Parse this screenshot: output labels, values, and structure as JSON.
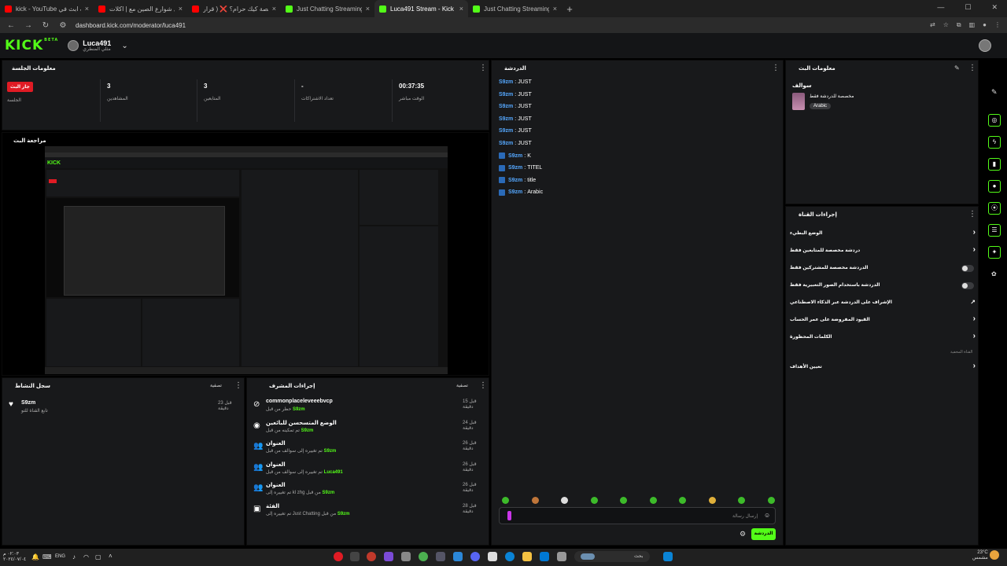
{
  "browser": {
    "tabs": [
      {
        "title": "kick - YouTube كيف ابث في",
        "color": "#ff0000",
        "active": false
      },
      {
        "title": "تجربة اكل شوارع الصين مع | اكلات",
        "color": "#ff0000",
        "active": false
      },
      {
        "title": "هل منصة كيك حرام؟ ❌ ( قرار",
        "color": "#ff0000",
        "active": false
      },
      {
        "title": "Just Chatting Streaming - Live",
        "color": "#53fc18",
        "active": false
      },
      {
        "title": "Luca491 Stream - Kick Dashbo",
        "color": "#53fc18",
        "active": true
      },
      {
        "title": "Just Chatting Streaming - Live",
        "color": "#53fc18",
        "active": false
      }
    ],
    "url": "dashboard.kick.com/moderator/luca491"
  },
  "header": {
    "logo": "KICK",
    "logo_badge": "BETA",
    "channel_name": "Luca491",
    "channel_sub": "مثلي المنطري"
  },
  "session": {
    "title": "معلومات الجلسة",
    "live_badge": "جار البث",
    "live_label": "الجلسة",
    "stats": [
      {
        "value": "3",
        "label": "المشاهدين"
      },
      {
        "value": "3",
        "label": "المتابعين"
      },
      {
        "value": "-",
        "label": "تعداد الاشتراكات"
      },
      {
        "value": "00:37:35",
        "label": "الوقت مباشر"
      }
    ]
  },
  "preview": {
    "title": "مراجعة البث"
  },
  "activity": {
    "title": "سجل النشاط",
    "filter": "تصفية",
    "items": [
      {
        "user": "S9zm",
        "text": "تابع القناة للتو",
        "time": "قبل 23 دقيقة"
      }
    ]
  },
  "mod_actions": {
    "title": "إجراءات المشرف",
    "filter": "تصفية",
    "items": [
      {
        "icon": "ban-icon",
        "title": "commonplaceleveeebvcp",
        "sub_pre": "حظر من قبل",
        "user": "S9zm",
        "time": "قبل 15 دقيقة"
      },
      {
        "icon": "eye-icon",
        "title": "الوضع المتسحسن للبائعين",
        "sub_pre": "تم تمكينه من قبل",
        "user": "S9zm",
        "time": "قبل 24 دقيقة"
      },
      {
        "icon": "users-icon",
        "title": "العنوان",
        "sub_pre": "تم تغييره إلى سوالف من قبل",
        "user": "S9zm",
        "time": "قبل 26 دقيقة"
      },
      {
        "icon": "users-icon",
        "title": "العنوان",
        "sub_pre": "تم تغييره إلى سوالف من قبل",
        "user": "Luca491",
        "time": "قبل 26 دقيقة"
      },
      {
        "icon": "users-icon",
        "title": "العنوان",
        "sub_pre": "تم تغييره إلى kl zhg من قبل",
        "user": "S9zm",
        "time": "قبل 26 دقيقة"
      },
      {
        "icon": "category-icon",
        "title": "الفئة",
        "sub_pre": "تم تغييره إلى Just Chatting من قبل",
        "user": "S9zm",
        "time": "قبل 28 دقيقة"
      }
    ]
  },
  "chat": {
    "title": "الدردشة",
    "messages": [
      {
        "user": "S9zm",
        "text": "JUST",
        "badge": false
      },
      {
        "user": "S9zm",
        "text": "JUST",
        "badge": false
      },
      {
        "user": "S9zm",
        "text": "JUST",
        "badge": false
      },
      {
        "user": "S9zm",
        "text": "JUST",
        "badge": false
      },
      {
        "user": "S9zm",
        "text": "JUST",
        "badge": false
      },
      {
        "user": "S9zm",
        "text": "JUST",
        "badge": false
      },
      {
        "user": "S9zm",
        "text": "K",
        "badge": true
      },
      {
        "user": "S9zm",
        "text": "TITEL",
        "badge": true
      },
      {
        "user": "S9zm",
        "text": "title",
        "badge": true
      },
      {
        "user": "S9zm",
        "text": "Arabic",
        "badge": true
      }
    ],
    "placeholder": "إرسال رسالة",
    "send_label": "الدردشة"
  },
  "stream_info": {
    "title": "معلومات البث",
    "stream_title": "سوالف",
    "category": "مخصصة للدردشة فقط",
    "tag": "Arabic"
  },
  "channel_actions": {
    "title": "إجراءات القناة",
    "items": [
      {
        "label": "الوضع البطيء",
        "control": "arrow"
      },
      {
        "label": "دردشة مخصصة للمتابعين فقط",
        "control": "arrow"
      },
      {
        "label": "الدردشة مخصصة للمشتركين فقط",
        "control": "toggle"
      },
      {
        "label": "الدردشة باستخدام الصور التعبيرية فقط",
        "control": "toggle"
      },
      {
        "label": "الإشراف على الدردشة عبر الذكاء الاصطناعي",
        "control": "external"
      },
      {
        "label": "القيود المفروضة على عمر الحساب",
        "control": "arrow"
      },
      {
        "label": "الكلمات المحظورة",
        "control": "arrow"
      }
    ],
    "section_label": "القناة المخفية",
    "extra_item": "تعيين الأهداف"
  },
  "taskbar": {
    "search": "بحث",
    "lang": "ENG",
    "weather": "23°C",
    "weather_sub": "مشمس",
    "time": "٠٢:٠٣ م",
    "date": "٢٠٢٤/٠٧/٠٤"
  }
}
